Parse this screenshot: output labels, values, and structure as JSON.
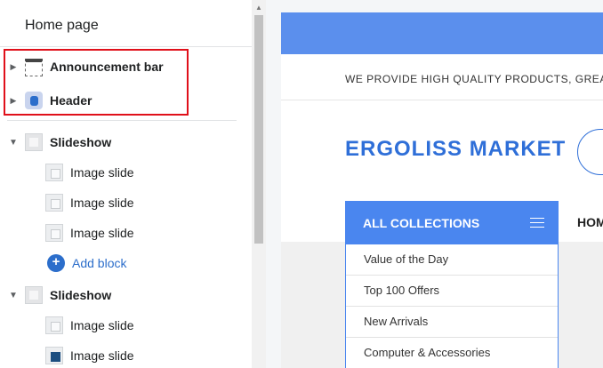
{
  "sidebar": {
    "title": "Home page",
    "items": [
      {
        "label": "Announcement bar",
        "icon": "announcement-bar-icon"
      },
      {
        "label": "Header",
        "icon": "header-icon"
      },
      {
        "label": "Slideshow",
        "icon": "slideshow-icon"
      },
      {
        "label": "Image slide",
        "icon": "image-icon"
      },
      {
        "label": "Image slide",
        "icon": "image-icon"
      },
      {
        "label": "Image slide",
        "icon": "image-icon"
      },
      {
        "label": "Add block",
        "icon": "add-icon"
      },
      {
        "label": "Slideshow",
        "icon": "slideshow-icon"
      },
      {
        "label": "Image slide",
        "icon": "image-icon"
      },
      {
        "label": "Image slide",
        "icon": "image-icon"
      }
    ],
    "highlight_color": "#e0101a"
  },
  "preview": {
    "tagline": "WE PROVIDE HIGH QUALITY PRODUCTS, GREAT S",
    "logo": "ERGOLISS MARKET",
    "nav_item": "HOM",
    "collections": {
      "title": "ALL COLLECTIONS",
      "items": [
        "Value of the Day",
        "Top 100 Offers",
        "New Arrivals",
        "Computer & Accessories"
      ]
    },
    "brand_color": "#4a86ef"
  }
}
